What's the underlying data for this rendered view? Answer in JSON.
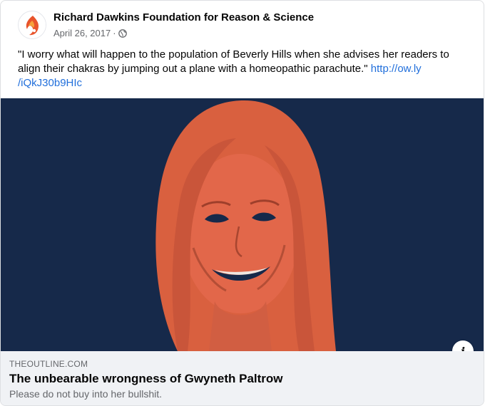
{
  "post": {
    "page_name": "Richard Dawkins Foundation for Reason & Science",
    "date": "April 26, 2017",
    "dot": "·",
    "privacy_icon": "globe-icon",
    "text_main": "\"I worry what will happen to the population of Beverly Hills when she advises her readers to align their chakras by jumping out a plane with a homeopathic parachute.\"",
    "link_text_line1": "http://ow.ly",
    "link_text_line2": "/iQkJ30b9HIc"
  },
  "link_preview": {
    "domain": "THEOUTLINE.COM",
    "title": "The unbearable wrongness of Gwyneth Paltrow",
    "description": "Please do not buy into her bullshit.",
    "info_label": "i"
  },
  "colors": {
    "image_background": "#16294a",
    "duotone_orange": "#e2674a",
    "link_blue": "#216fdb",
    "logo_orange": "#e8542c"
  }
}
